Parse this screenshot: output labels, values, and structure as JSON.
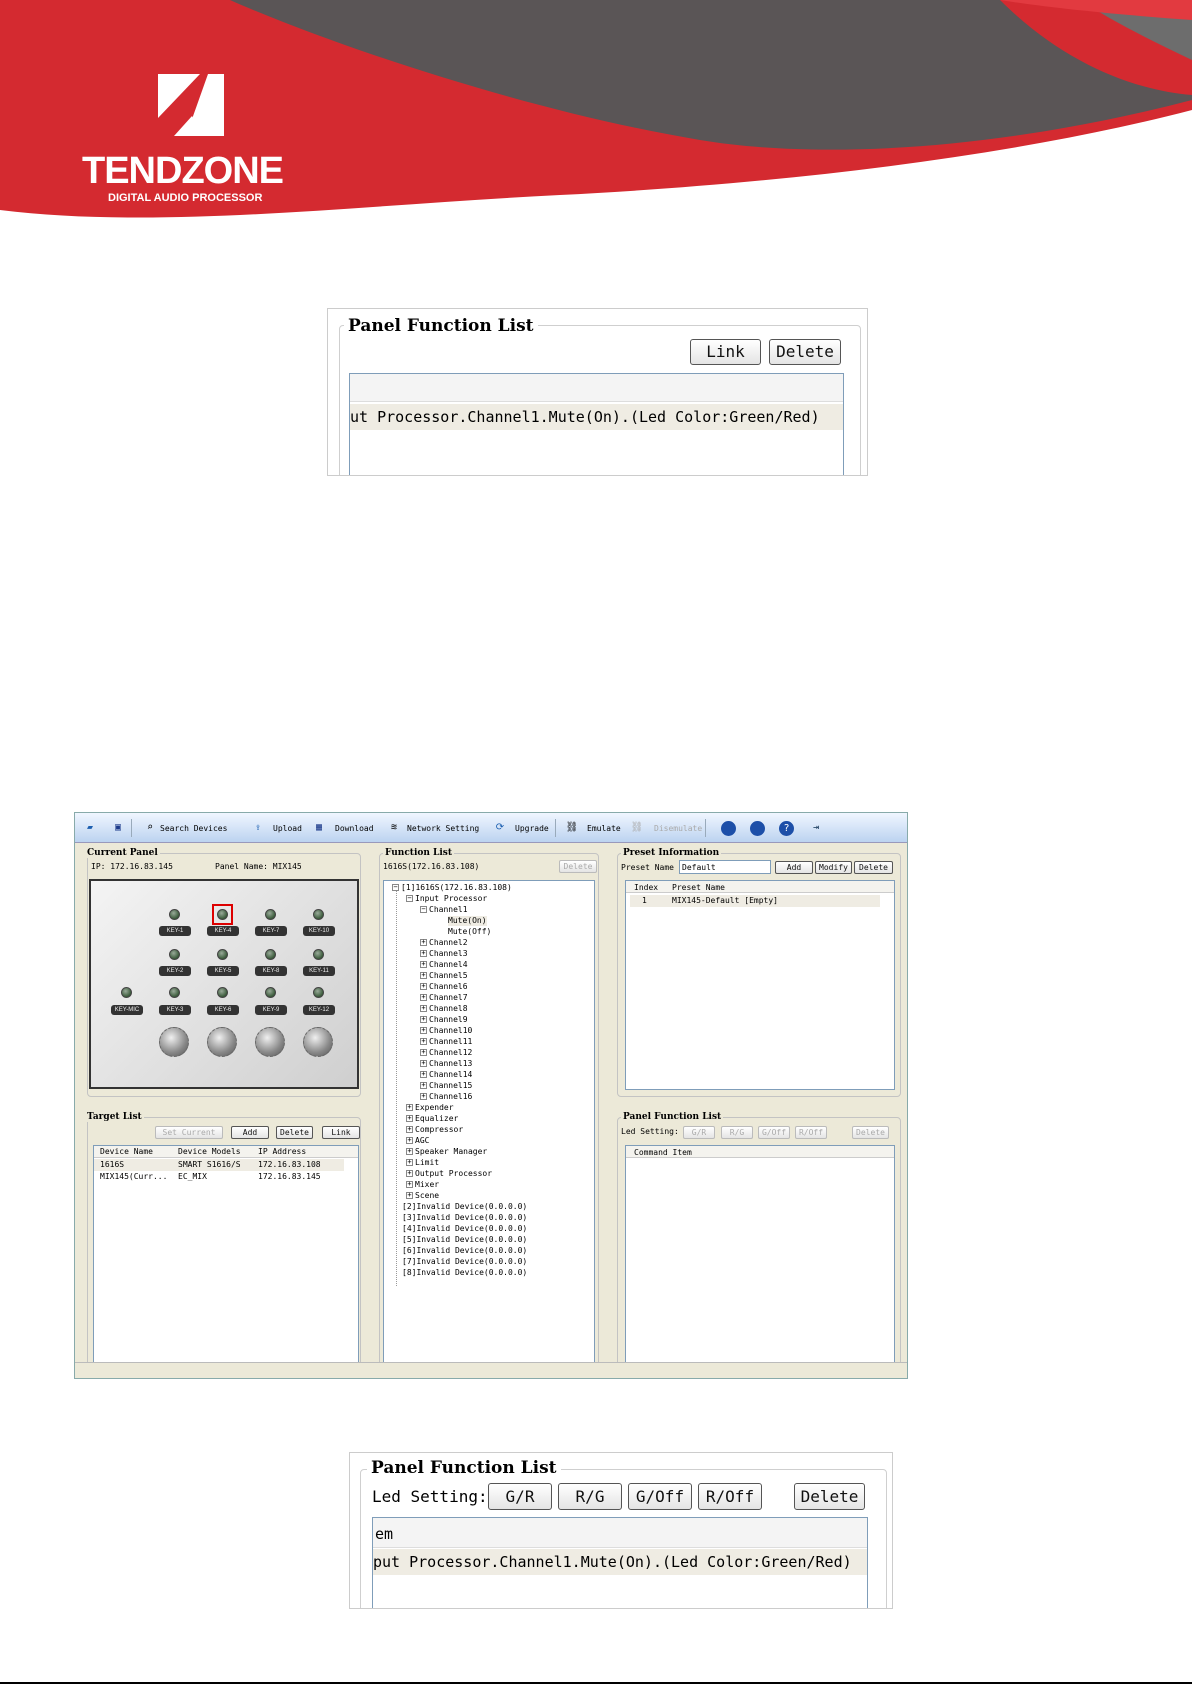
{
  "brand": {
    "name": "TENDZONE",
    "tagline": "DIGITAL AUDIO PROCESSOR",
    "colors": {
      "red": "#d42a30",
      "dark": "#5a5556",
      "gray": "#6d6d6d"
    }
  },
  "crop1": {
    "title": "Panel Function List",
    "link_label": "Link",
    "delete_label": "Delete",
    "row_text": "ut Processor.Channel1.Mute(On).(Led Color:Green/Red)"
  },
  "app": {
    "toolbar": {
      "search": "Search Devices",
      "upload": "Upload",
      "download": "Download",
      "network": "Network Setting",
      "upgrade": "Upgrade",
      "emulate": "Emulate",
      "disemulate": "Disemulate"
    },
    "current_panel": {
      "title": "Current Panel",
      "ip": "IP: 172.16.83.145",
      "panel_name": "Panel Name: MIX145",
      "keys": [
        "KEY-1",
        "KEY-4",
        "KEY-7",
        "KEY-10",
        "KEY-2",
        "KEY-5",
        "KEY-8",
        "KEY-11",
        "KEY-MIC",
        "KEY-3",
        "KEY-6",
        "KEY-9",
        "KEY-12"
      ]
    },
    "function_list": {
      "title": "Function List",
      "device": "1616S(172.16.83.108)",
      "delete_label": "Delete",
      "tree": [
        "[1]1616S(172.16.83.108)",
        "Input Processor",
        "Channel1",
        "Mute(On)",
        "Mute(Off)",
        "Channel2",
        "Channel3",
        "Channel4",
        "Channel5",
        "Channel6",
        "Channel7",
        "Channel8",
        "Channel9",
        "Channel10",
        "Channel11",
        "Channel12",
        "Channel13",
        "Channel14",
        "Channel15",
        "Channel16",
        "Expender",
        "Equalizer",
        "Compressor",
        "AGC",
        "Speaker Manager",
        "Limit",
        "Output Processor",
        "Mixer",
        "Scene",
        "[2]Invalid Device(0.0.0.0)",
        "[3]Invalid Device(0.0.0.0)",
        "[4]Invalid Device(0.0.0.0)",
        "[5]Invalid Device(0.0.0.0)",
        "[6]Invalid Device(0.0.0.0)",
        "[7]Invalid Device(0.0.0.0)",
        "[8]Invalid Device(0.0.0.0)"
      ]
    },
    "preset": {
      "title": "Preset Information",
      "name_label": "Preset Name",
      "name_value": "Default",
      "add": "Add",
      "modify": "Modify",
      "delete": "Delete",
      "columns": [
        "Index",
        "Preset Name"
      ],
      "rows": [
        [
          "1",
          "MIX145-Default [Empty]"
        ]
      ]
    },
    "target_list": {
      "title": "Target List",
      "set_current": "Set Current",
      "add": "Add",
      "delete": "Delete",
      "link": "Link",
      "columns": [
        "Device Name",
        "Device Models",
        "IP Address"
      ],
      "rows": [
        [
          "1616S",
          "SMART S1616/S",
          "172.16.83.108"
        ],
        [
          "MIX145(Curr...",
          "EC_MIX",
          "172.16.83.145"
        ]
      ]
    },
    "panel_function": {
      "title": "Panel Function List",
      "led_label": "Led Setting:",
      "buttons": [
        "G/R",
        "R/G",
        "G/Off",
        "R/Off"
      ],
      "delete": "Delete",
      "column": "Command Item"
    }
  },
  "crop2": {
    "title": "Panel Function List",
    "led_label": "Led Setting:",
    "buttons": [
      "G/R",
      "R/G",
      "G/Off",
      "R/Off"
    ],
    "delete_label": "Delete",
    "header_text": "em",
    "row_text": "put Processor.Channel1.Mute(On).(Led Color:Green/Red)"
  }
}
